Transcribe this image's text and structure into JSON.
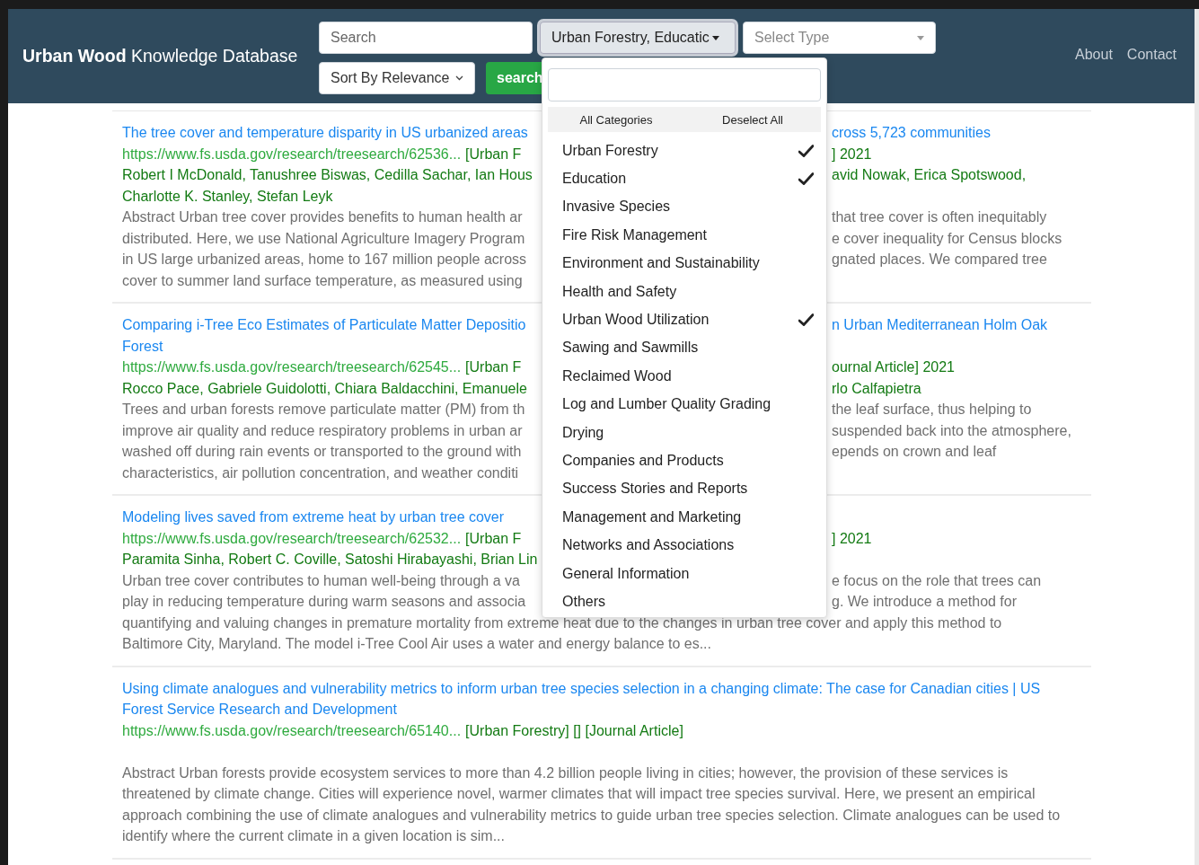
{
  "navbar": {
    "brand": "**Urban Wood** Knowledge Database",
    "search": {
      "placeholder": "Search"
    },
    "category_select": {
      "value": "Urban Forestry, Educatic",
      "expanded": true
    },
    "type_select": {
      "placeholder": "Select Type"
    },
    "sort_select": {
      "value": "Sort By Relevance"
    },
    "search_button": "search",
    "links": [
      "About",
      "Contact"
    ]
  },
  "category_dropdown": {
    "actions": [
      "All Categories",
      "Deselect All"
    ],
    "items": [
      {
        "label": "Urban Forestry",
        "checked": true
      },
      {
        "label": "Education",
        "checked": true
      },
      {
        "label": "Invasive Species",
        "checked": false
      },
      {
        "label": "Fire Risk Management",
        "checked": false
      },
      {
        "label": "Environment and Sustainability",
        "checked": false
      },
      {
        "label": "Health and Safety",
        "checked": false
      },
      {
        "label": "Urban Wood Utilization",
        "checked": true
      },
      {
        "label": "Sawing and Sawmills",
        "checked": false
      },
      {
        "label": "Reclaimed Wood",
        "checked": false
      },
      {
        "label": "Log and Lumber Quality Grading",
        "checked": false
      },
      {
        "label": "Drying",
        "checked": false
      },
      {
        "label": "Companies and Products",
        "checked": false
      },
      {
        "label": "Success Stories and Reports",
        "checked": false
      },
      {
        "label": "Management and Marketing",
        "checked": false
      },
      {
        "label": "Networks and Associations",
        "checked": false
      },
      {
        "label": "General Information",
        "checked": false
      },
      {
        "label": "Others",
        "checked": false
      }
    ]
  },
  "results": [
    {
      "lines": [
        {
          "kind": "title",
          "left": "The tree cover and temperature disparity in US urbanized areas",
          "right": "cross 5,723 communities"
        },
        {
          "kind": "url",
          "left": "https://www.fs.usda.gov/research/treesearch/62536...",
          "tags": "[Urban F",
          "right": "] 2021"
        },
        {
          "kind": "authors",
          "left": "Robert I McDonald, Tanushree Biswas, Cedilla Sachar, Ian Hous",
          "right": "avid Nowak, Erica Spotswood,"
        },
        {
          "kind": "authors",
          "left": "Charlotte K. Stanley, Stefan Leyk"
        },
        {
          "kind": "abstract",
          "left": "Abstract Urban tree cover provides benefits to human health ar",
          "right": "that tree cover is often inequitably"
        },
        {
          "kind": "abstract",
          "left": "distributed. Here, we use National Agriculture Imagery Program",
          "right": "e cover inequality for Census blocks"
        },
        {
          "kind": "abstract",
          "left": "in US large urbanized areas, home to 167 million people across",
          "right": "gnated places. We compared tree"
        },
        {
          "kind": "abstract",
          "left": "cover to summer land surface temperature, as measured using"
        }
      ]
    },
    {
      "lines": [
        {
          "kind": "title",
          "left": "Comparing i-Tree Eco Estimates of Particulate Matter Depositio",
          "right": "n Urban Mediterranean Holm Oak"
        },
        {
          "kind": "title",
          "left": "Forest"
        },
        {
          "kind": "url",
          "left": "https://www.fs.usda.gov/research/treesearch/62545...",
          "tags": "[Urban F",
          "right": "ournal Article] 2021"
        },
        {
          "kind": "authors",
          "left": "Rocco Pace, Gabriele Guidolotti, Chiara Baldacchini, Emanuele",
          "right": "rlo Calfapietra"
        },
        {
          "kind": "abstract",
          "left": "Trees and urban forests remove particulate matter (PM) from th",
          "right": "the leaf surface, thus helping to"
        },
        {
          "kind": "abstract",
          "left": "improve air quality and reduce respiratory problems in urban ar",
          "right": "suspended back into the atmosphere,"
        },
        {
          "kind": "abstract",
          "left": "washed off during rain events or transported to the ground with",
          "right": "epends on crown and leaf"
        },
        {
          "kind": "abstract",
          "left": "characteristics, air pollution concentration, and weather conditi"
        }
      ]
    },
    {
      "lines": [
        {
          "kind": "title",
          "left": "Modeling lives saved from extreme heat by urban tree cover"
        },
        {
          "kind": "url",
          "left": "https://www.fs.usda.gov/research/treesearch/62532...",
          "tags": "[Urban F",
          "right": "] 2021"
        },
        {
          "kind": "authors",
          "left": "Paramita Sinha, Robert C. Coville, Satoshi Hirabayashi, Brian Lin"
        },
        {
          "kind": "abstract",
          "left": "Urban tree cover contributes to human well-being through a va",
          "right": "e focus on the role that trees can"
        },
        {
          "kind": "abstract",
          "left": "play in reducing temperature during warm seasons and associa",
          "right": "g. We introduce a method for"
        },
        {
          "kind": "abstract",
          "left": "quantifying and valuing changes in premature mortality from extreme heat due to the changes in urban tree cover and apply this method to"
        },
        {
          "kind": "abstract",
          "left": "Baltimore City, Maryland. The model i-Tree Cool Air uses a water and energy balance to es..."
        }
      ]
    },
    {
      "lines": [
        {
          "kind": "title",
          "left": "Using climate analogues and vulnerability metrics to inform urban tree species selection in a changing climate: The case for Canadian cities | US Forest Service Research and Development"
        },
        {
          "kind": "url",
          "left": "https://www.fs.usda.gov/research/treesearch/65140...",
          "tags": "[Urban Forestry] [] [Journal Article]"
        },
        {
          "kind": "abstract",
          "left": "Abstract Urban forests provide ecosystem services to more than 4.2 billion people living in cities; however, the provision of these services is threatened by climate change. Cities will experience novel, warmer climates that will impact tree species survival. Here, we present an empirical approach combining the use of climate analogues and vulnerability metrics to guide urban tree species selection. Climate analogues can be used to identify where the current climate in a given location is sim..."
        }
      ]
    }
  ]
}
